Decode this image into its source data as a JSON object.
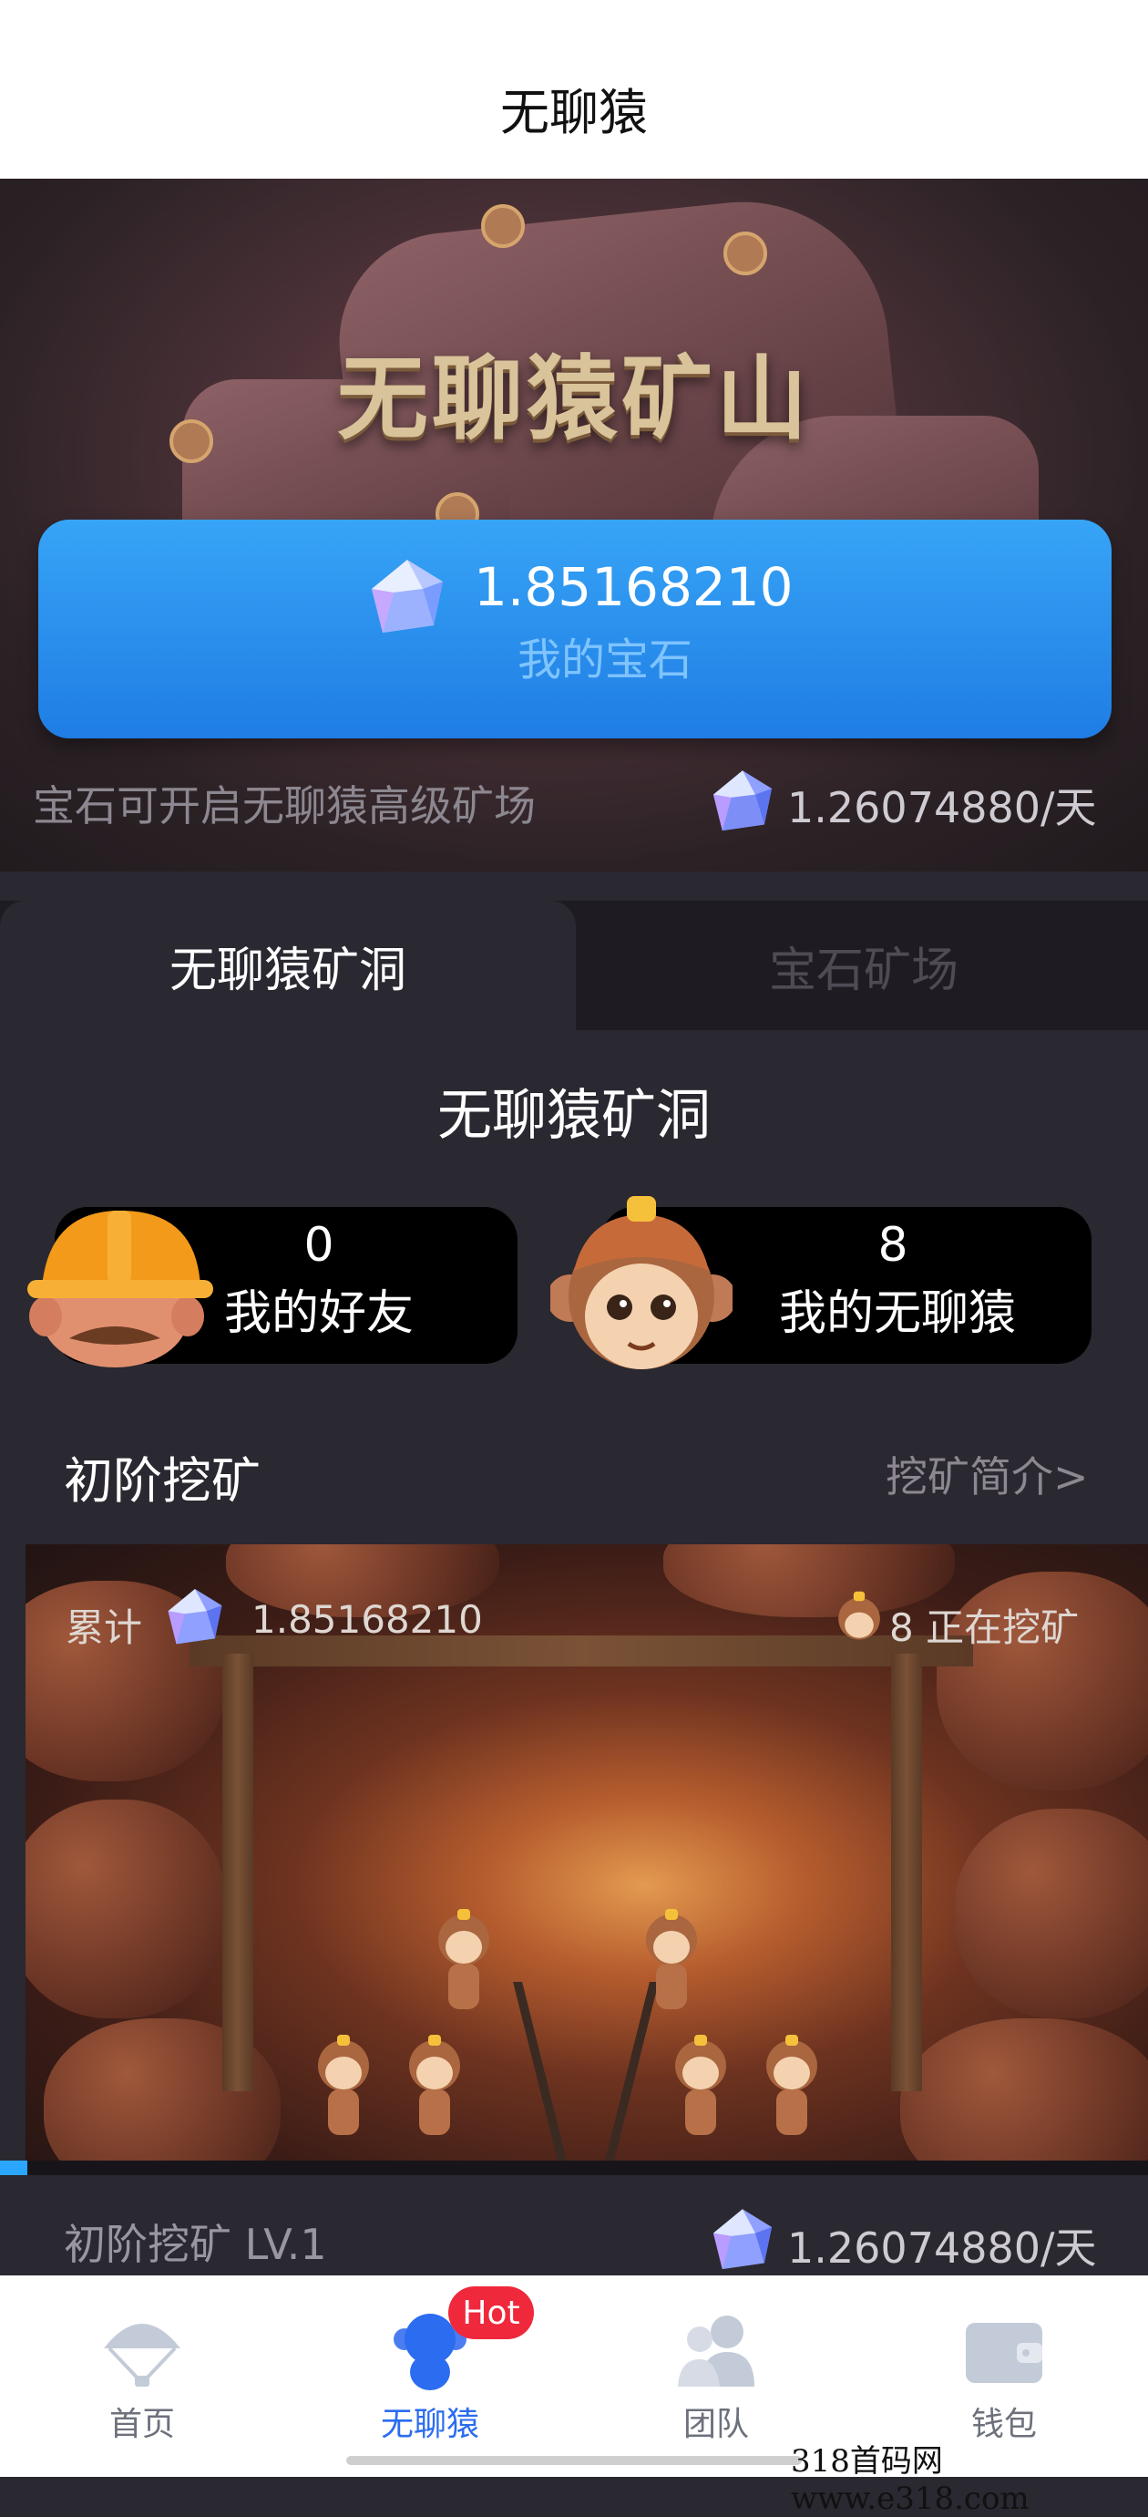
{
  "header": {
    "title": "无聊猿"
  },
  "hero": {
    "title": "无聊猿矿山",
    "gem_balance": "1.85168210",
    "gem_label": "我的宝石",
    "gem_note": "宝石可开启无聊猿高级矿场",
    "gem_rate": "1.26074880/天"
  },
  "tabs": [
    {
      "label": "无聊猿矿洞",
      "active": true
    },
    {
      "label": "宝石矿场",
      "active": false
    }
  ],
  "section": {
    "title": "无聊猿矿洞",
    "friends": {
      "count": "0",
      "label": "我的好友"
    },
    "apes": {
      "count": "8",
      "label": "我的无聊猿"
    }
  },
  "mining": {
    "title": "初阶挖矿",
    "intro_link": "挖矿简介>",
    "total_label": "累计",
    "total_value": "1.85168210",
    "active_count": "8 正在挖矿",
    "level_label": "初阶挖矿 LV.1",
    "level_rate": "1.26074880/天"
  },
  "nav": {
    "items": [
      {
        "label": "首页",
        "icon": "parachute-icon"
      },
      {
        "label": "无聊猿",
        "icon": "monkey-icon",
        "active": true
      },
      {
        "label": "团队",
        "icon": "team-icon"
      },
      {
        "label": "钱包",
        "icon": "wallet-icon"
      }
    ],
    "hot_badge": "Hot"
  },
  "watermark": "318首码网 www.e318.com",
  "colors": {
    "accent_blue": "#1f7de4",
    "nav_active": "#2b6cf0",
    "hot_red": "#f0283c"
  }
}
